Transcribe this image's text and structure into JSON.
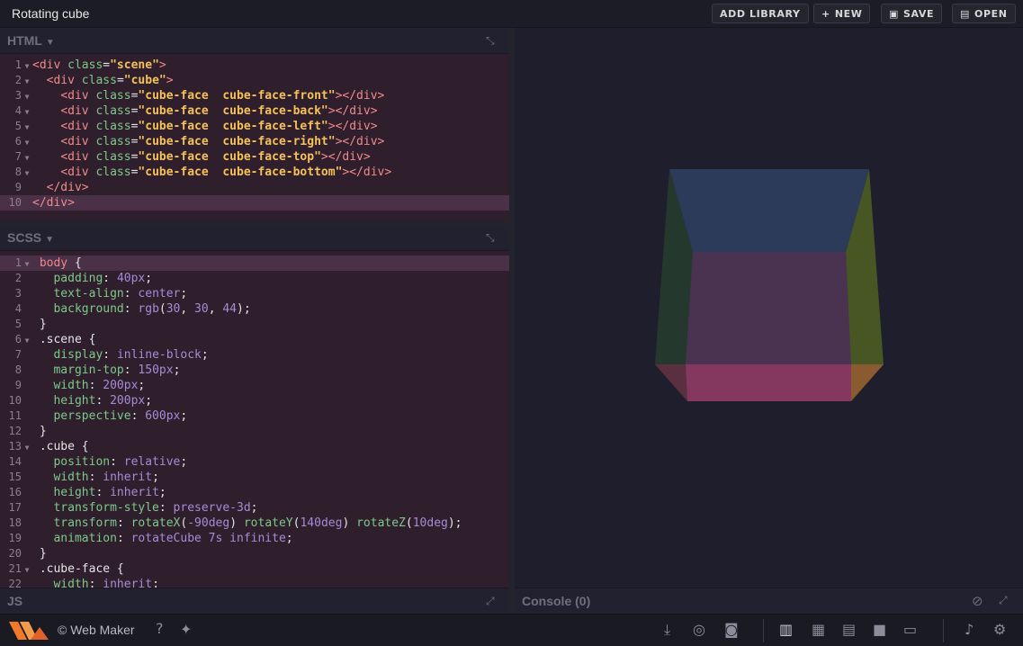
{
  "app": {
    "title": "Rotating cube"
  },
  "toolbar": {
    "add_library": "ADD LIBRARY",
    "new": "NEW",
    "save": "SAVE",
    "open": "OPEN"
  },
  "html_pane": {
    "title": "HTML",
    "lines": [
      {
        "n": "1",
        "fold": true
      },
      {
        "n": "2",
        "fold": true
      },
      {
        "n": "3",
        "fold": true
      },
      {
        "n": "4",
        "fold": true
      },
      {
        "n": "5",
        "fold": true
      },
      {
        "n": "6",
        "fold": true
      },
      {
        "n": "7",
        "fold": true
      },
      {
        "n": "8",
        "fold": true
      },
      {
        "n": "9",
        "fold": false
      },
      {
        "n": "10",
        "fold": false
      }
    ]
  },
  "scss_pane": {
    "title": "SCSS",
    "lines": [
      {
        "n": "1"
      },
      {
        "n": "2"
      },
      {
        "n": "3"
      },
      {
        "n": "4"
      },
      {
        "n": "5"
      },
      {
        "n": "6"
      },
      {
        "n": "7"
      },
      {
        "n": "8"
      },
      {
        "n": "9"
      },
      {
        "n": "10"
      },
      {
        "n": "11"
      },
      {
        "n": "12"
      },
      {
        "n": "13"
      },
      {
        "n": "14"
      },
      {
        "n": "15"
      },
      {
        "n": "16"
      },
      {
        "n": "17"
      },
      {
        "n": "18"
      },
      {
        "n": "19"
      },
      {
        "n": "20"
      },
      {
        "n": "21"
      },
      {
        "n": "22"
      }
    ]
  },
  "js_pane": {
    "title": "JS"
  },
  "console": {
    "title": "Console (0)"
  },
  "footer": {
    "brand": "© Web Maker"
  },
  "colors": {
    "accent_logo": "#f07a2a",
    "editor_bg": "#2f1f2d",
    "active_line": "#4a3147",
    "cube_top": "#2c3b59",
    "cube_front": "#4a3350",
    "cube_left": "#263a2e",
    "cube_right": "#4a5a22",
    "cube_bottom_front": "#84385f"
  }
}
